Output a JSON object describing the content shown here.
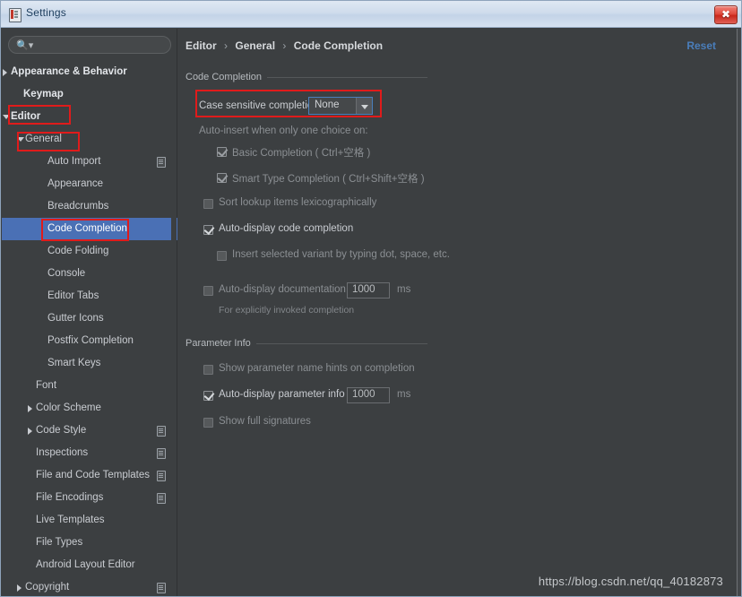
{
  "window": {
    "title": "Settings",
    "app_icon": "settings-app-icon",
    "close_label": "✖"
  },
  "sidebar": {
    "search": {
      "placeholder": "",
      "value": "",
      "icon": "search-icon"
    },
    "items": [
      {
        "label": "Appearance & Behavior",
        "indent": 10,
        "arrow": "right",
        "bold": true,
        "doc": false,
        "selected": false
      },
      {
        "label": "Keymap",
        "indent": 24,
        "arrow": "none",
        "bold": true,
        "doc": false,
        "selected": false
      },
      {
        "label": "Editor",
        "indent": 10,
        "arrow": "down",
        "bold": true,
        "doc": false,
        "selected": false
      },
      {
        "label": "General",
        "indent": 26,
        "arrow": "down",
        "bold": false,
        "doc": false,
        "selected": false
      },
      {
        "label": "Auto Import",
        "indent": 51,
        "arrow": "none",
        "bold": false,
        "doc": true,
        "selected": false
      },
      {
        "label": "Appearance",
        "indent": 51,
        "arrow": "none",
        "bold": false,
        "doc": false,
        "selected": false
      },
      {
        "label": "Breadcrumbs",
        "indent": 51,
        "arrow": "none",
        "bold": false,
        "doc": false,
        "selected": false
      },
      {
        "label": "Code Completion",
        "indent": 51,
        "arrow": "none",
        "bold": false,
        "doc": false,
        "selected": true
      },
      {
        "label": "Code Folding",
        "indent": 51,
        "arrow": "none",
        "bold": false,
        "doc": false,
        "selected": false
      },
      {
        "label": "Console",
        "indent": 51,
        "arrow": "none",
        "bold": false,
        "doc": false,
        "selected": false
      },
      {
        "label": "Editor Tabs",
        "indent": 51,
        "arrow": "none",
        "bold": false,
        "doc": false,
        "selected": false
      },
      {
        "label": "Gutter Icons",
        "indent": 51,
        "arrow": "none",
        "bold": false,
        "doc": false,
        "selected": false
      },
      {
        "label": "Postfix Completion",
        "indent": 51,
        "arrow": "none",
        "bold": false,
        "doc": false,
        "selected": false
      },
      {
        "label": "Smart Keys",
        "indent": 51,
        "arrow": "none",
        "bold": false,
        "doc": false,
        "selected": false
      },
      {
        "label": "Font",
        "indent": 38,
        "arrow": "none",
        "bold": false,
        "doc": false,
        "selected": false
      },
      {
        "label": "Color Scheme",
        "indent": 38,
        "arrow": "right",
        "bold": false,
        "doc": false,
        "selected": false
      },
      {
        "label": "Code Style",
        "indent": 38,
        "arrow": "right",
        "bold": false,
        "doc": true,
        "selected": false
      },
      {
        "label": "Inspections",
        "indent": 38,
        "arrow": "none",
        "bold": false,
        "doc": true,
        "selected": false
      },
      {
        "label": "File and Code Templates",
        "indent": 38,
        "arrow": "none",
        "bold": false,
        "doc": true,
        "selected": false
      },
      {
        "label": "File Encodings",
        "indent": 38,
        "arrow": "none",
        "bold": false,
        "doc": true,
        "selected": false
      },
      {
        "label": "Live Templates",
        "indent": 38,
        "arrow": "none",
        "bold": false,
        "doc": false,
        "selected": false
      },
      {
        "label": "File Types",
        "indent": 38,
        "arrow": "none",
        "bold": false,
        "doc": false,
        "selected": false
      },
      {
        "label": "Android Layout Editor",
        "indent": 38,
        "arrow": "none",
        "bold": false,
        "doc": false,
        "selected": false
      },
      {
        "label": "Copyright",
        "indent": 26,
        "arrow": "right",
        "bold": false,
        "doc": true,
        "selected": false
      }
    ]
  },
  "main": {
    "breadcrumb": {
      "part1": "Editor",
      "part2": "General",
      "part3": "Code Completion",
      "separator": "›"
    },
    "reset_label": "Reset",
    "code_completion": {
      "group_label": "Code Completion",
      "case_sensitive_label": "Case sensitive completion:",
      "case_sensitive_value": "None",
      "auto_insert_label": "Auto-insert when only one choice on:",
      "basic_completion_label": "Basic Completion ( Ctrl+空格 )",
      "smart_type_label": "Smart Type Completion ( Ctrl+Shift+空格 )",
      "sort_lookup_label": "Sort lookup items lexicographically",
      "auto_display_code_label": "Auto-display code completion",
      "insert_variant_label": "Insert selected variant by typing dot, space, etc.",
      "auto_display_doc_label": "Auto-display documentation in",
      "auto_display_doc_value": "1000",
      "auto_display_doc_unit": "ms",
      "explicit_hint": "For explicitly invoked completion"
    },
    "parameter_info": {
      "group_label": "Parameter Info",
      "show_hints_label": "Show parameter name hints on completion",
      "auto_display_param_label": "Auto-display parameter info in",
      "auto_display_param_value": "1000",
      "auto_display_param_unit": "ms",
      "show_full_signatures_label": "Show full signatures"
    }
  },
  "watermark": "https://blog.csdn.net/qq_40182873",
  "colors": {
    "accent_selection": "#4a70b5",
    "link": "#4a7ebb",
    "annotation": "#e01b1b",
    "panel_bg": "#3c3f41",
    "titlebar": "#cfdcec"
  }
}
